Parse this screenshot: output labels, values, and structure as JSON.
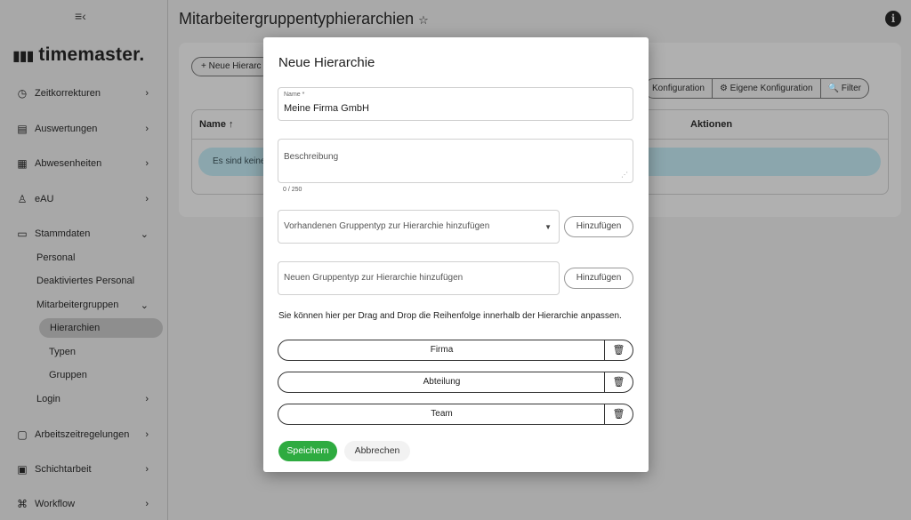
{
  "app": {
    "logo_mark": "▮▮▮",
    "logo_text": "timemaster.",
    "menu_icon": "≡‹"
  },
  "sidebar": {
    "items": [
      {
        "label": "Zeitkorrekturen",
        "icon": "clock-icon",
        "glyph": "◷",
        "chev": "›"
      },
      {
        "label": "Auswertungen",
        "icon": "chart-icon",
        "glyph": "▤",
        "chev": "›"
      },
      {
        "label": "Abwesenheiten",
        "icon": "calendar-x-icon",
        "glyph": "▦",
        "chev": "›"
      },
      {
        "label": "eAU",
        "icon": "user-health-icon",
        "glyph": "♙",
        "chev": "›"
      },
      {
        "label": "Stammdaten",
        "icon": "folder-icon",
        "glyph": "▭",
        "chev": "⌄"
      },
      {
        "label": "Arbeitszeitregelungen",
        "icon": "schedule-rule-icon",
        "glyph": "▢",
        "chev": "›"
      },
      {
        "label": "Schichtarbeit",
        "icon": "calendar-check-icon",
        "glyph": "▣",
        "chev": "›"
      },
      {
        "label": "Workflow",
        "icon": "workflow-icon",
        "glyph": "⌘",
        "chev": "›"
      }
    ],
    "sub": {
      "personal": "Personal",
      "deaktiviert": "Deaktiviertes Personal",
      "mitarbeitergruppen": "Mitarbeitergruppen",
      "mitarbeitergruppen_chev": "⌄",
      "hierarchien": "Hierarchien",
      "typen": "Typen",
      "gruppen": "Gruppen",
      "login": "Login",
      "login_chev": "›"
    }
  },
  "page": {
    "title": "Mitarbeitergruppentyphierarchien",
    "star": "☆",
    "info": "i",
    "add_button": "+ Neue Hierarc",
    "toolbar": {
      "config": "Konfiguration",
      "own_config": "⚙ Eigene Konfiguration",
      "filter": "🔍 Filter"
    },
    "table": {
      "col_name": "Name ↑",
      "col_actions": "Aktionen",
      "empty": "Es sind keine"
    }
  },
  "modal": {
    "title": "Neue Hierarchie",
    "name_label": "Name *",
    "name_value": "Meine Firma GmbH",
    "desc_placeholder": "Beschreibung",
    "counter": "0 / 250",
    "select_placeholder": "Vorhandenen Gruppentyp zur Hierarchie hinzufügen",
    "select_arrow": "▼",
    "new_placeholder": "Neuen Gruppentyp zur Hierarchie hinzufügen",
    "add_label": "Hinzufügen",
    "hint": "Sie können hier per Drag and Drop die Reihenfolge innerhalb der Hierarchie anpassen.",
    "rows": [
      "Firma",
      "Abteilung",
      "Team"
    ],
    "delete_glyph": "🗑",
    "save": "Speichern",
    "cancel": "Abbrechen"
  }
}
